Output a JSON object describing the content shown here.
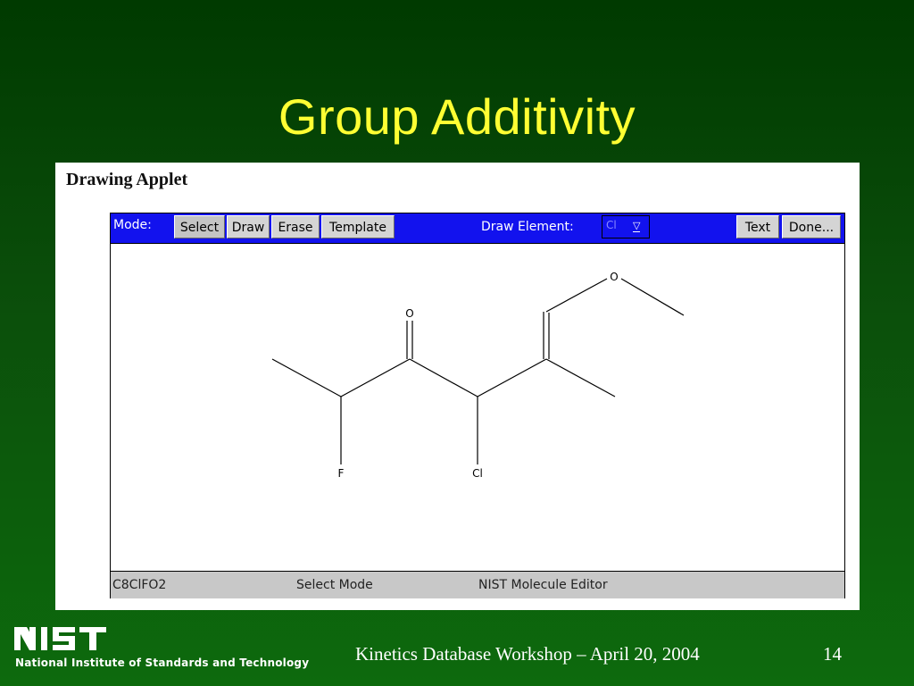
{
  "slide": {
    "title": "Group Additivity",
    "footer": "Kinetics Database Workshop – April 20, 2004",
    "page_number": "14",
    "logo_text": "NIST",
    "logo_subtitle": "National Institute of Standards and Technology"
  },
  "applet": {
    "title": "Drawing Applet",
    "toolbar": {
      "mode_label": "Mode:",
      "buttons": [
        "Select",
        "Draw",
        "Erase",
        "Template"
      ],
      "active_mode": "Select",
      "draw_element_label": "Draw Element:",
      "draw_element_value": "Cl",
      "text_button": "Text",
      "done_button": "Done..."
    },
    "molecule": {
      "atoms": {
        "o_carbonyl": "O",
        "o_ether": "O",
        "f": "F",
        "cl": "Cl"
      }
    },
    "status": {
      "formula": "C8ClFO2",
      "mode": "Select Mode",
      "app_name": "NIST Molecule Editor"
    }
  }
}
